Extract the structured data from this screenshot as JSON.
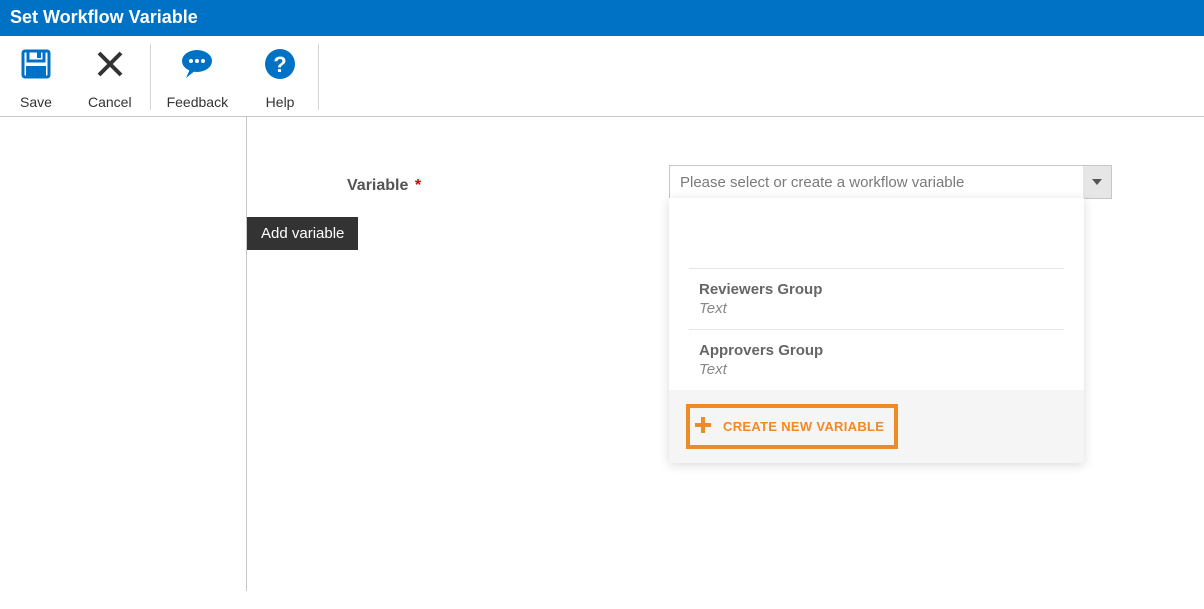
{
  "title": "Set Workflow Variable",
  "ribbon": {
    "save": "Save",
    "cancel": "Cancel",
    "feedback": "Feedback",
    "help": "Help"
  },
  "form": {
    "variableLabel": "Variable",
    "requiredMark": "*",
    "selectPlaceholder": "Please select or create a workflow variable",
    "tooltip": "Add variable"
  },
  "dropdown": {
    "options": [
      {
        "name": "Reviewers Group",
        "type": "Text"
      },
      {
        "name": "Approvers Group",
        "type": "Text"
      }
    ],
    "createNew": "CREATE NEW VARIABLE"
  }
}
